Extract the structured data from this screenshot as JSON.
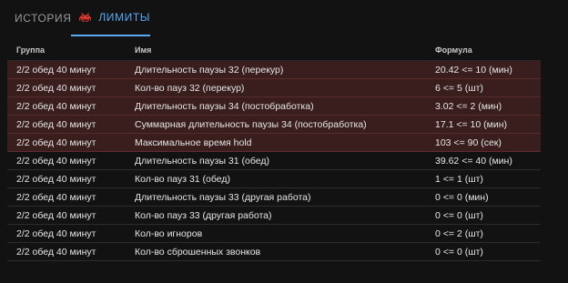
{
  "tabs": [
    {
      "label": "ИСТОРИЯ",
      "icon": "",
      "active": false
    },
    {
      "label": "ЛИМИТЫ",
      "icon": "space-invader-icon",
      "active": true
    }
  ],
  "colors": {
    "accent": "#5aa9f2",
    "icon_red": "#e53935",
    "violated_row_bg": "#3a1d1d",
    "background": "#121212"
  },
  "table": {
    "headers": {
      "group": "Группа",
      "name": "Имя",
      "formula": "Формула"
    },
    "rows": [
      {
        "group": "2/2 обед 40 минут",
        "name": "Длительность паузы 32 (перекур)",
        "formula": "20.42 <= 10 (мин)",
        "violated": true
      },
      {
        "group": "2/2 обед 40 минут",
        "name": "Кол-во пауз 32 (перекур)",
        "formula": "6 <= 5 (шт)",
        "violated": true
      },
      {
        "group": "2/2 обед 40 минут",
        "name": "Длительность паузы 34 (постобработка)",
        "formula": "3.02 <= 2 (мин)",
        "violated": true
      },
      {
        "group": "2/2 обед 40 минут",
        "name": "Суммарная длительность паузы 34 (постобработка)",
        "formula": "17.1 <= 10 (мин)",
        "violated": true
      },
      {
        "group": "2/2 обед 40 минут",
        "name": "Максимальное время hold",
        "formula": "103 <= 90 (сек)",
        "violated": true
      },
      {
        "group": "2/2 обед 40 минут",
        "name": "Длительность паузы 31 (обед)",
        "formula": "39.62 <= 40 (мин)",
        "violated": false
      },
      {
        "group": "2/2 обед 40 минут",
        "name": "Кол-во пауз 31 (обед)",
        "formula": "1 <= 1 (шт)",
        "violated": false
      },
      {
        "group": "2/2 обед 40 минут",
        "name": "Длительность паузы 33 (другая работа)",
        "formula": "0 <= 0 (мин)",
        "violated": false
      },
      {
        "group": "2/2 обед 40 минут",
        "name": "Кол-во пауз 33 (другая работа)",
        "formula": "0 <= 0 (шт)",
        "violated": false
      },
      {
        "group": "2/2 обед 40 минут",
        "name": "Кол-во игноров",
        "formula": "0 <= 2 (шт)",
        "violated": false
      },
      {
        "group": "2/2 обед 40 минут",
        "name": "Кол-во сброшенных звонков",
        "formula": "0 <= 0 (шт)",
        "violated": false
      }
    ]
  }
}
